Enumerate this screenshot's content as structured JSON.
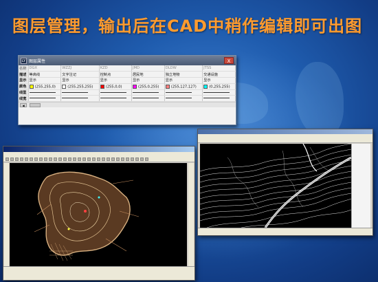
{
  "slide": {
    "title": "图层管理，输出后在CAD中稍作编辑即可出图"
  },
  "layer_manager": {
    "window_title": "图层属性",
    "close_label": "X",
    "row_labels": [
      "名称",
      "描述",
      "显示",
      "颜色",
      "线型",
      "线宽"
    ],
    "layers": [
      {
        "name": "DGX",
        "desc": "等高线",
        "display": "显示",
        "color_text": "(255,255,0)",
        "color_hex": "#ffff00"
      },
      {
        "name": "WZZJ",
        "desc": "文字注记",
        "display": "显示",
        "color_text": "(255,255,255)",
        "color_hex": "#ffffff"
      },
      {
        "name": "KZD",
        "desc": "控制点",
        "display": "显示",
        "color_text": "(255,0,0)",
        "color_hex": "#ff0000"
      },
      {
        "name": "JMD",
        "desc": "居民地",
        "display": "显示",
        "color_text": "(255,0,255)",
        "color_hex": "#ff00ff"
      },
      {
        "name": "DLDW",
        "desc": "独立地物",
        "display": "显示",
        "color_text": "(255,127,127)",
        "color_hex": "#ff7f7f"
      },
      {
        "name": "JTSS",
        "desc": "交通设施",
        "display": "显示",
        "color_text": "(0,255,255)",
        "color_hex": "#00ffff"
      }
    ]
  },
  "colors": {
    "title_orange": "#ff9b2e",
    "background_blue": "#1f5cae",
    "contour_lines": "#c8a070"
  },
  "icons": {
    "layer_window_icon": "app-icon",
    "close": "close-icon"
  }
}
